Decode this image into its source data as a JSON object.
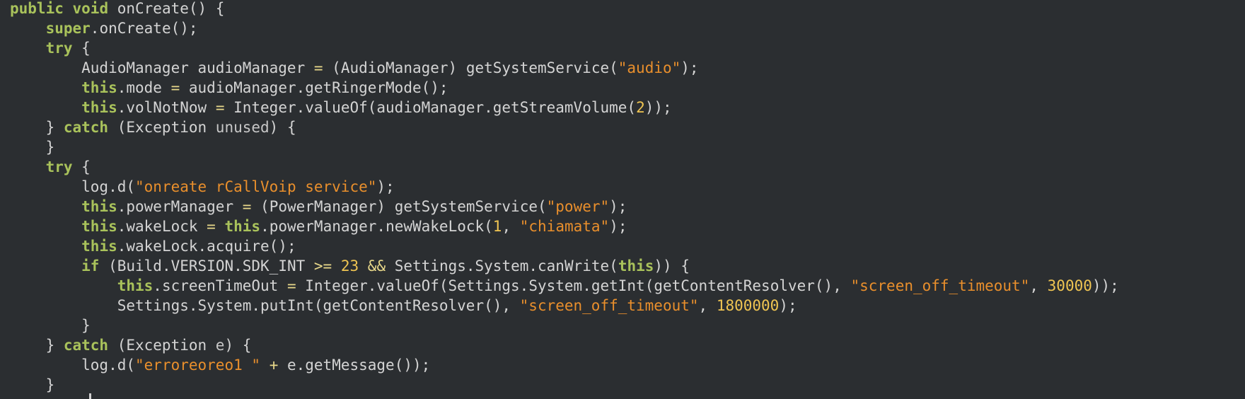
{
  "colors": {
    "background": "#2b2e31",
    "keyword": "#a9c25b",
    "string": "#e98f2c",
    "number": "#f0c552",
    "operator": "#e8d88a",
    "text": "#d4d4d4"
  },
  "code": {
    "lines": [
      [
        {
          "t": "kw",
          "v": "public"
        },
        {
          "t": "plain",
          "v": " "
        },
        {
          "t": "kw",
          "v": "void"
        },
        {
          "t": "plain",
          "v": " onCreate() {"
        }
      ],
      [
        {
          "t": "plain",
          "v": "    "
        },
        {
          "t": "kw",
          "v": "super"
        },
        {
          "t": "plain",
          "v": ".onCreate();"
        }
      ],
      [
        {
          "t": "plain",
          "v": "    "
        },
        {
          "t": "kw",
          "v": "try"
        },
        {
          "t": "plain",
          "v": " {"
        }
      ],
      [
        {
          "t": "plain",
          "v": "        AudioManager audioManager "
        },
        {
          "t": "op",
          "v": "="
        },
        {
          "t": "plain",
          "v": " (AudioManager) getSystemService("
        },
        {
          "t": "str",
          "v": "\"audio\""
        },
        {
          "t": "plain",
          "v": ");"
        }
      ],
      [
        {
          "t": "plain",
          "v": "        "
        },
        {
          "t": "kw",
          "v": "this"
        },
        {
          "t": "plain",
          "v": ".mode "
        },
        {
          "t": "op",
          "v": "="
        },
        {
          "t": "plain",
          "v": " audioManager.getRingerMode();"
        }
      ],
      [
        {
          "t": "plain",
          "v": "        "
        },
        {
          "t": "kw",
          "v": "this"
        },
        {
          "t": "plain",
          "v": ".volNotNow "
        },
        {
          "t": "op",
          "v": "="
        },
        {
          "t": "plain",
          "v": " Integer.valueOf(audioManager.getStreamVolume("
        },
        {
          "t": "num",
          "v": "2"
        },
        {
          "t": "plain",
          "v": "));"
        }
      ],
      [
        {
          "t": "plain",
          "v": "    } "
        },
        {
          "t": "kw",
          "v": "catch"
        },
        {
          "t": "plain",
          "v": " (Exception "
        },
        {
          "t": "var",
          "v": "unused"
        },
        {
          "t": "plain",
          "v": ") {"
        }
      ],
      [
        {
          "t": "plain",
          "v": "    }"
        }
      ],
      [
        {
          "t": "plain",
          "v": "    "
        },
        {
          "t": "kw",
          "v": "try"
        },
        {
          "t": "plain",
          "v": " {"
        }
      ],
      [
        {
          "t": "plain",
          "v": "        log.d("
        },
        {
          "t": "str",
          "v": "\"onreate rCallVoip service\""
        },
        {
          "t": "plain",
          "v": ");"
        }
      ],
      [
        {
          "t": "plain",
          "v": "        "
        },
        {
          "t": "kw",
          "v": "this"
        },
        {
          "t": "plain",
          "v": ".powerManager "
        },
        {
          "t": "op",
          "v": "="
        },
        {
          "t": "plain",
          "v": " (PowerManager) getSystemService("
        },
        {
          "t": "str",
          "v": "\"power\""
        },
        {
          "t": "plain",
          "v": ");"
        }
      ],
      [
        {
          "t": "plain",
          "v": "        "
        },
        {
          "t": "kw",
          "v": "this"
        },
        {
          "t": "plain",
          "v": ".wakeLock "
        },
        {
          "t": "op",
          "v": "="
        },
        {
          "t": "plain",
          "v": " "
        },
        {
          "t": "kw",
          "v": "this"
        },
        {
          "t": "plain",
          "v": ".powerManager.newWakeLock("
        },
        {
          "t": "num",
          "v": "1"
        },
        {
          "t": "plain",
          "v": ", "
        },
        {
          "t": "str",
          "v": "\"chiamata\""
        },
        {
          "t": "plain",
          "v": ");"
        }
      ],
      [
        {
          "t": "plain",
          "v": "        "
        },
        {
          "t": "kw",
          "v": "this"
        },
        {
          "t": "plain",
          "v": ".wakeLock.acquire();"
        }
      ],
      [
        {
          "t": "plain",
          "v": "        "
        },
        {
          "t": "kw",
          "v": "if"
        },
        {
          "t": "plain",
          "v": " (Build.VERSION.SDK_INT "
        },
        {
          "t": "op",
          "v": ">="
        },
        {
          "t": "plain",
          "v": " "
        },
        {
          "t": "num",
          "v": "23"
        },
        {
          "t": "plain",
          "v": " "
        },
        {
          "t": "op",
          "v": "&&"
        },
        {
          "t": "plain",
          "v": " Settings.System.canWrite("
        },
        {
          "t": "kw",
          "v": "this"
        },
        {
          "t": "plain",
          "v": ")) {"
        }
      ],
      [
        {
          "t": "plain",
          "v": "            "
        },
        {
          "t": "kw",
          "v": "this"
        },
        {
          "t": "plain",
          "v": ".screenTimeOut "
        },
        {
          "t": "op",
          "v": "="
        },
        {
          "t": "plain",
          "v": " Integer.valueOf(Settings.System.getInt(getContentResolver(), "
        },
        {
          "t": "str",
          "v": "\"screen_off_timeout\""
        },
        {
          "t": "plain",
          "v": ", "
        },
        {
          "t": "num",
          "v": "30000"
        },
        {
          "t": "plain",
          "v": "));"
        }
      ],
      [
        {
          "t": "plain",
          "v": "            Settings.System.putInt(getContentResolver(), "
        },
        {
          "t": "str",
          "v": "\"screen_off_timeout\""
        },
        {
          "t": "plain",
          "v": ", "
        },
        {
          "t": "num",
          "v": "1800000"
        },
        {
          "t": "plain",
          "v": ");"
        }
      ],
      [
        {
          "t": "plain",
          "v": "        }"
        }
      ],
      [
        {
          "t": "plain",
          "v": "    } "
        },
        {
          "t": "kw",
          "v": "catch"
        },
        {
          "t": "plain",
          "v": " (Exception "
        },
        {
          "t": "var",
          "v": "e"
        },
        {
          "t": "plain",
          "v": ") {"
        }
      ],
      [
        {
          "t": "plain",
          "v": "        log.d("
        },
        {
          "t": "str",
          "v": "\"erroreoreo1 \""
        },
        {
          "t": "plain",
          "v": " "
        },
        {
          "t": "op",
          "v": "+"
        },
        {
          "t": "plain",
          "v": " e.getMessage());"
        }
      ],
      [
        {
          "t": "plain",
          "v": "    }"
        }
      ]
    ]
  }
}
